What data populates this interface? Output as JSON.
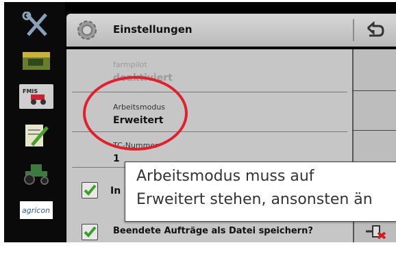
{
  "header": {
    "title": "Einstellungen",
    "icon": "gear-icon",
    "back_icon": "back-arrow-icon"
  },
  "sidebar": {
    "items": [
      {
        "icon": "tools-icon"
      },
      {
        "icon": "field-tractor-icon"
      },
      {
        "icon": "fmis-icon",
        "label": "FMIS",
        "selected": true
      },
      {
        "icon": "notepad-icon"
      },
      {
        "icon": "tractor-icon"
      },
      {
        "icon": "agricon-logo",
        "label": "agricon"
      }
    ]
  },
  "settings": {
    "rows": [
      {
        "label": "farmpilot",
        "value": "deaktiviert",
        "disabled": true
      },
      {
        "label": "Arbeitsmodus",
        "value": "Erweitert",
        "disabled": false
      },
      {
        "label": "TC-Nummer",
        "value": "1",
        "disabled": false
      }
    ],
    "checkbox_row_partial": "In",
    "bottom_row_label": "Beendete Aufträge als Datei speichern?"
  },
  "tooltip": {
    "line1": "Arbeitsmodus muss auf",
    "line2": "Erweitert stehen, ansonsten än"
  },
  "annotation": {
    "highlight_color": "#e0202a"
  }
}
